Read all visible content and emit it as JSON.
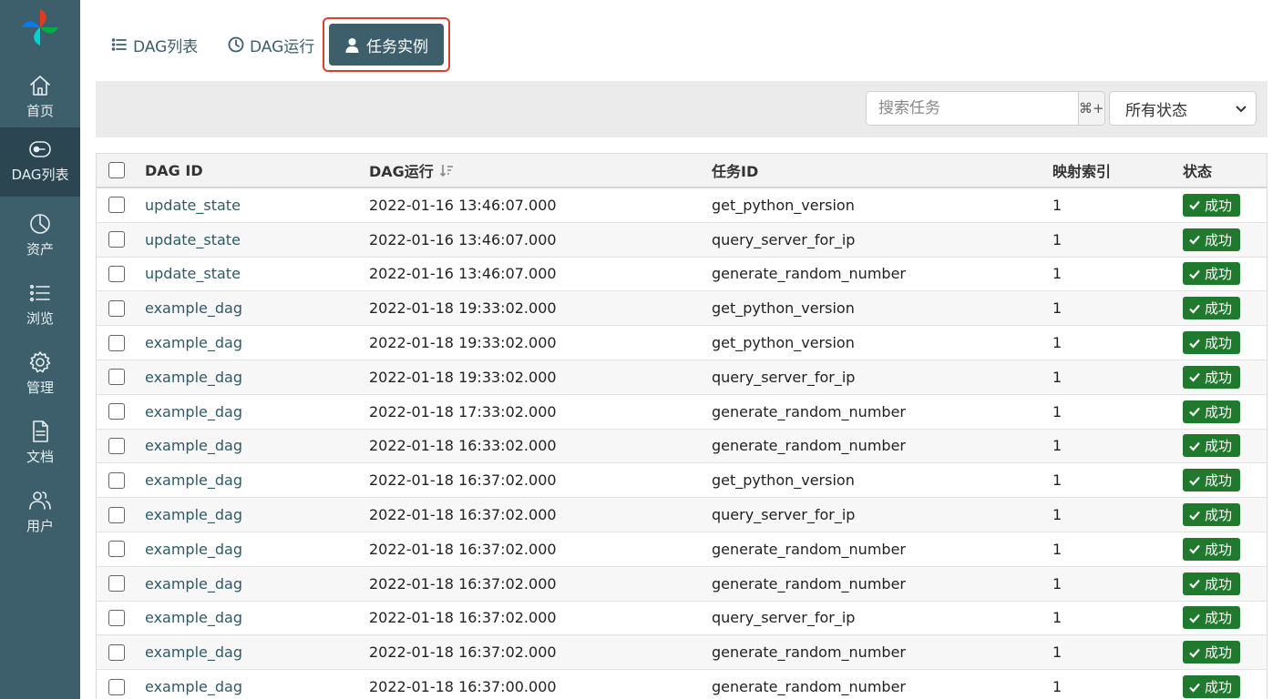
{
  "sidebar": {
    "items": [
      {
        "label": "首页",
        "icon": "home-icon"
      },
      {
        "label": "DAG列表",
        "icon": "dag-icon",
        "active": true
      },
      {
        "label": "资产",
        "icon": "asset-icon"
      },
      {
        "label": "浏览",
        "icon": "browse-icon"
      },
      {
        "label": "管理",
        "icon": "gear-icon"
      },
      {
        "label": "文档",
        "icon": "document-icon"
      },
      {
        "label": "用户",
        "icon": "users-icon"
      }
    ]
  },
  "tabs": {
    "dag_list": "DAG列表",
    "dag_runs": "DAG运行",
    "task_instances": "任务实例"
  },
  "toolbar": {
    "search_placeholder": "搜索任务",
    "shortcut": "⌘+K",
    "status_filter": "所有状态"
  },
  "table": {
    "headers": {
      "dag_id": "DAG ID",
      "dag_run": "DAG运行",
      "task_id": "任务ID",
      "map_index": "映射索引",
      "state": "状态"
    },
    "rows": [
      {
        "dag_id": "update_state",
        "dag_run": "2022-01-16 13:46:07.000",
        "task_id": "get_python_version",
        "map_index": "1",
        "state": "成功"
      },
      {
        "dag_id": "update_state",
        "dag_run": "2022-01-16 13:46:07.000",
        "task_id": "query_server_for_ip",
        "map_index": "1",
        "state": "成功"
      },
      {
        "dag_id": "update_state",
        "dag_run": "2022-01-16 13:46:07.000",
        "task_id": "generate_random_number",
        "map_index": "1",
        "state": "成功"
      },
      {
        "dag_id": "example_dag",
        "dag_run": "2022-01-18 19:33:02.000",
        "task_id": "get_python_version",
        "map_index": "1",
        "state": "成功"
      },
      {
        "dag_id": "example_dag",
        "dag_run": "2022-01-18 19:33:02.000",
        "task_id": "get_python_version",
        "map_index": "1",
        "state": "成功"
      },
      {
        "dag_id": "example_dag",
        "dag_run": "2022-01-18 19:33:02.000",
        "task_id": "query_server_for_ip",
        "map_index": "1",
        "state": "成功"
      },
      {
        "dag_id": "example_dag",
        "dag_run": "2022-01-18 17:33:02.000",
        "task_id": "generate_random_number",
        "map_index": "1",
        "state": "成功"
      },
      {
        "dag_id": "example_dag",
        "dag_run": "2022-01-18 16:33:02.000",
        "task_id": "generate_random_number",
        "map_index": "1",
        "state": "成功"
      },
      {
        "dag_id": "example_dag",
        "dag_run": "2022-01-18 16:37:02.000",
        "task_id": "get_python_version",
        "map_index": "1",
        "state": "成功"
      },
      {
        "dag_id": "example_dag",
        "dag_run": "2022-01-18 16:37:02.000",
        "task_id": "query_server_for_ip",
        "map_index": "1",
        "state": "成功"
      },
      {
        "dag_id": "example_dag",
        "dag_run": "2022-01-18 16:37:02.000",
        "task_id": "generate_random_number",
        "map_index": "1",
        "state": "成功"
      },
      {
        "dag_id": "example_dag",
        "dag_run": "2022-01-18 16:37:02.000",
        "task_id": "generate_random_number",
        "map_index": "1",
        "state": "成功"
      },
      {
        "dag_id": "example_dag",
        "dag_run": "2022-01-18 16:37:02.000",
        "task_id": "query_server_for_ip",
        "map_index": "1",
        "state": "成功"
      },
      {
        "dag_id": "example_dag",
        "dag_run": "2022-01-18 16:37:02.000",
        "task_id": "generate_random_number",
        "map_index": "1",
        "state": "成功"
      },
      {
        "dag_id": "example_dag",
        "dag_run": "2022-01-18 16:37:00.000",
        "task_id": "generate_random_number",
        "map_index": "1",
        "state": "成功"
      }
    ]
  },
  "colors": {
    "sidebar": "#3d5f6b",
    "sidebar_active": "#2b4650",
    "success": "#1f7a2e",
    "highlight_outline": "#d9402e"
  }
}
